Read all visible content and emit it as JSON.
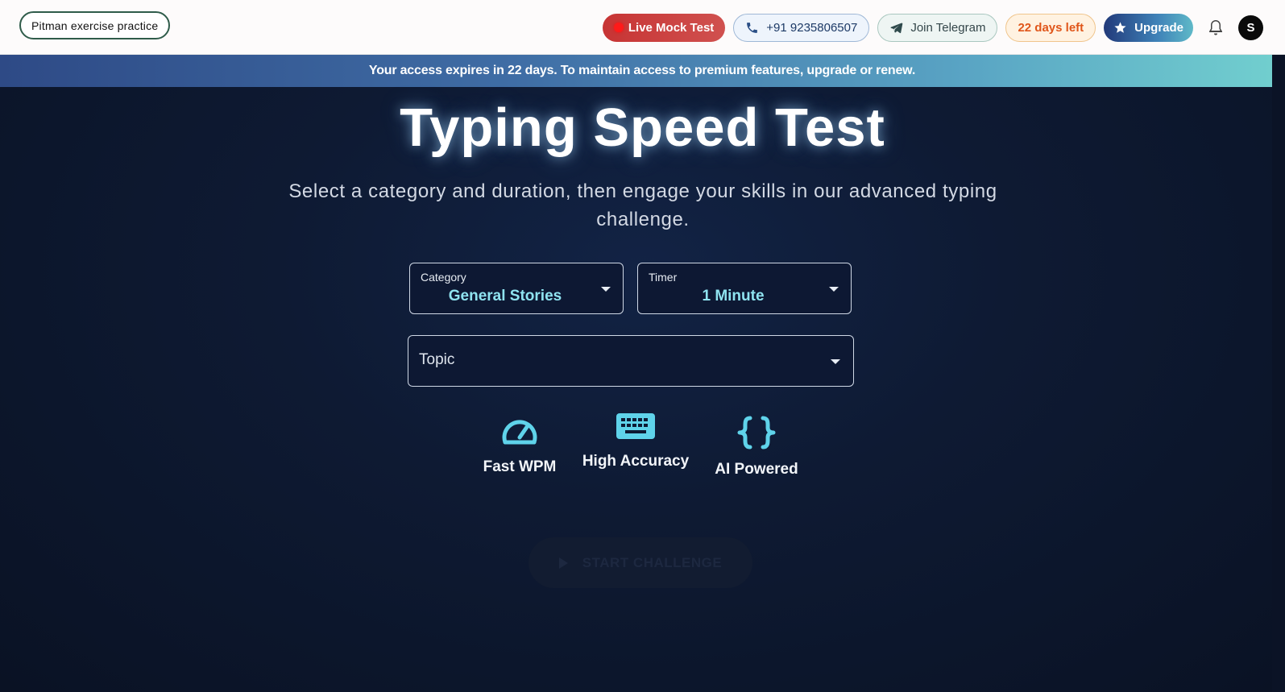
{
  "header": {
    "brand": "Pitman exercise practice",
    "live_mock": "Live Mock Test",
    "phone": "+91 9235806507",
    "telegram": "Join Telegram",
    "days_left": "22 days left",
    "upgrade": "Upgrade",
    "avatar_initial": "S",
    "icons": [
      "phone-icon",
      "telegram-icon",
      "star-icon",
      "bell-icon"
    ]
  },
  "notice": {
    "text": "Your access expires in 22 days. To maintain access to premium features, upgrade or renew."
  },
  "main": {
    "title": "Typing Speed Test",
    "subtitle": "Select a category and duration, then engage your skills in our advanced typing challenge.",
    "category": {
      "label": "Category",
      "value": "General Stories"
    },
    "timer": {
      "label": "Timer",
      "value": "1 Minute"
    },
    "topic": {
      "placeholder": "Topic"
    },
    "features": [
      {
        "label": "Fast WPM",
        "icon": "speedometer-icon"
      },
      {
        "label": "High Accuracy",
        "icon": "keyboard-icon"
      },
      {
        "label": "AI Powered",
        "icon": "code-braces-icon"
      }
    ],
    "start_label": "START CHALLENGE"
  },
  "colors": {
    "accent": "#5fd3ea",
    "live": "#c73434",
    "days": "#e0561a",
    "background": "#0b1326"
  }
}
